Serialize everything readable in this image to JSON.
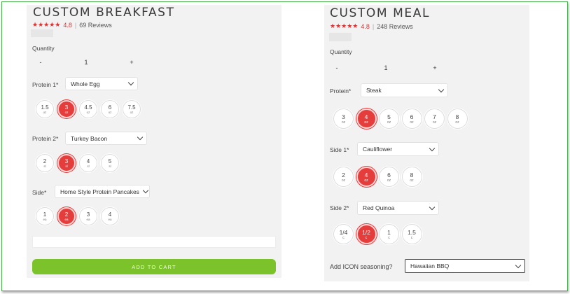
{
  "breakfast": {
    "title": "CUSTOM BREAKFAST",
    "stars": "★★★★★",
    "rating": "4.8",
    "reviews": "69 Reviews",
    "quantity": {
      "label": "Quantity",
      "minus": "-",
      "value": "1",
      "plus": "+"
    },
    "protein1": {
      "label": "Protein 1*",
      "selected": "Whole Egg",
      "sizes": [
        {
          "num": "1.5",
          "unit": "oz",
          "selected": false
        },
        {
          "num": "3",
          "unit": "oz",
          "selected": true
        },
        {
          "num": "4.5",
          "unit": "oz",
          "selected": false
        },
        {
          "num": "6",
          "unit": "oz",
          "selected": false
        },
        {
          "num": "7.5",
          "unit": "oz",
          "selected": false
        }
      ]
    },
    "protein2": {
      "label": "Protein 2*",
      "selected": "Turkey Bacon",
      "sizes": [
        {
          "num": "2",
          "unit": "sl",
          "selected": false
        },
        {
          "num": "3",
          "unit": "sl",
          "selected": true
        },
        {
          "num": "4",
          "unit": "sl",
          "selected": false
        },
        {
          "num": "5",
          "unit": "sl",
          "selected": false
        }
      ]
    },
    "side": {
      "label": "Side*",
      "selected": "Home Style Protein Pancakes",
      "sizes": [
        {
          "num": "1",
          "unit": "ea",
          "selected": false
        },
        {
          "num": "2",
          "unit": "ea",
          "selected": true
        },
        {
          "num": "3",
          "unit": "ea",
          "selected": false
        },
        {
          "num": "4",
          "unit": "ea",
          "selected": false
        }
      ]
    },
    "add_to_cart": "ADD TO CART"
  },
  "meal": {
    "title": "CUSTOM MEAL",
    "stars": "★★★★★",
    "rating": "4.8",
    "reviews": "248 Reviews",
    "quantity": {
      "label": "Quantity",
      "minus": "-",
      "value": "1",
      "plus": "+"
    },
    "protein": {
      "label": "Protein*",
      "selected": "Steak",
      "sizes": [
        {
          "num": "3",
          "unit": "oz",
          "selected": false
        },
        {
          "num": "4",
          "unit": "oz",
          "selected": true
        },
        {
          "num": "5",
          "unit": "oz",
          "selected": false
        },
        {
          "num": "6",
          "unit": "oz",
          "selected": false
        },
        {
          "num": "7",
          "unit": "oz",
          "selected": false
        },
        {
          "num": "8",
          "unit": "oz",
          "selected": false
        }
      ]
    },
    "side1": {
      "label": "Side 1*",
      "selected": "Cauliflower",
      "sizes": [
        {
          "num": "2",
          "unit": "oz",
          "selected": false
        },
        {
          "num": "4",
          "unit": "oz",
          "selected": true
        },
        {
          "num": "6",
          "unit": "oz",
          "selected": false
        },
        {
          "num": "8",
          "unit": "oz",
          "selected": false
        }
      ]
    },
    "side2": {
      "label": "Side 2*",
      "selected": "Red Quinoa",
      "sizes": [
        {
          "num": "1/4",
          "unit": "c",
          "selected": false
        },
        {
          "num": "1/2",
          "unit": "c",
          "selected": true
        },
        {
          "num": "1",
          "unit": "c",
          "selected": false
        },
        {
          "num": "1.5",
          "unit": "c",
          "selected": false
        }
      ]
    },
    "seasoning": {
      "label": "Add ICON seasoning?",
      "selected": "Hawaiian BBQ"
    }
  }
}
